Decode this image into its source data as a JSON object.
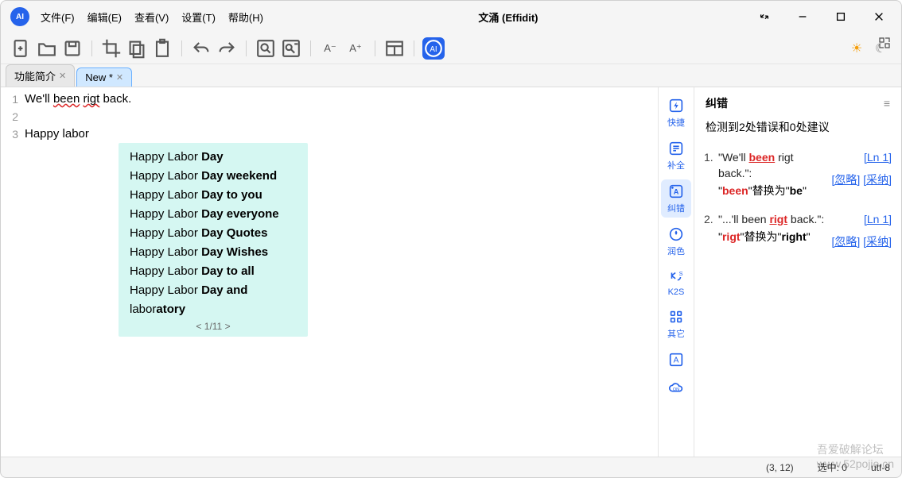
{
  "app": {
    "title": "文涌 (Effidit)"
  },
  "menus": [
    "文件(F)",
    "编辑(E)",
    "查看(V)",
    "设置(T)",
    "帮助(H)"
  ],
  "tabs": [
    {
      "label": "功能简介",
      "active": false
    },
    {
      "label": "New *",
      "active": true
    }
  ],
  "editor": {
    "lines": [
      {
        "n": "1",
        "segments": [
          {
            "t": "We'll "
          },
          {
            "t": "been",
            "err": true
          },
          {
            "t": " "
          },
          {
            "t": "rigt",
            "err": true
          },
          {
            "t": " back."
          }
        ]
      },
      {
        "n": "2",
        "segments": []
      },
      {
        "n": "3",
        "segments": [
          {
            "t": "Happy labor"
          }
        ]
      }
    ]
  },
  "suggestions": {
    "items": [
      {
        "pre": "Happy Labor ",
        "bold": "Day"
      },
      {
        "pre": "Happy Labor ",
        "bold": "Day weekend"
      },
      {
        "pre": "Happy Labor ",
        "bold": "Day to you"
      },
      {
        "pre": "Happy Labor ",
        "bold": "Day everyone"
      },
      {
        "pre": "Happy Labor ",
        "bold": "Day Quotes"
      },
      {
        "pre": "Happy Labor ",
        "bold": "Day Wishes"
      },
      {
        "pre": "Happy Labor ",
        "bold": "Day to all"
      },
      {
        "pre": "Happy Labor ",
        "bold": "Day and"
      },
      {
        "pre": "labor",
        "bold": "atory"
      }
    ],
    "pager": "< 1/11 >"
  },
  "sidebar": {
    "items": [
      {
        "label": "快捷",
        "icon": "bolt"
      },
      {
        "label": "补全",
        "icon": "complete"
      },
      {
        "label": "纠错",
        "icon": "correct",
        "active": true
      },
      {
        "label": "润色",
        "icon": "polish"
      },
      {
        "label": "K2S",
        "icon": "k2s"
      },
      {
        "label": "其它",
        "icon": "grid"
      }
    ],
    "extra": [
      "A",
      "on"
    ]
  },
  "panel": {
    "title": "纠错",
    "summary": "检测到2处错误和0处建议",
    "issues": [
      {
        "num": "1.",
        "quote_before": "\"We'll ",
        "quote_err": "been",
        "quote_after": " rigt back.\":",
        "from": "been",
        "to": "be",
        "ln": "[Ln 1]",
        "actions": [
          "[忽略]",
          "[采纳]"
        ]
      },
      {
        "num": "2.",
        "quote_before": "\"...'ll been ",
        "quote_err": "rigt",
        "quote_after": " back.\":",
        "from": "rigt",
        "to": "right",
        "ln": "[Ln 1]",
        "actions": [
          "[忽略]",
          "[采纳]"
        ]
      }
    ],
    "replace_mid": "替换为"
  },
  "status": {
    "pos": "(3, 12)",
    "sel": "选中: 0",
    "enc": "utf-8"
  },
  "watermark": {
    "line1": "吾爱破解论坛",
    "line2": "www.52pojie.cn"
  }
}
